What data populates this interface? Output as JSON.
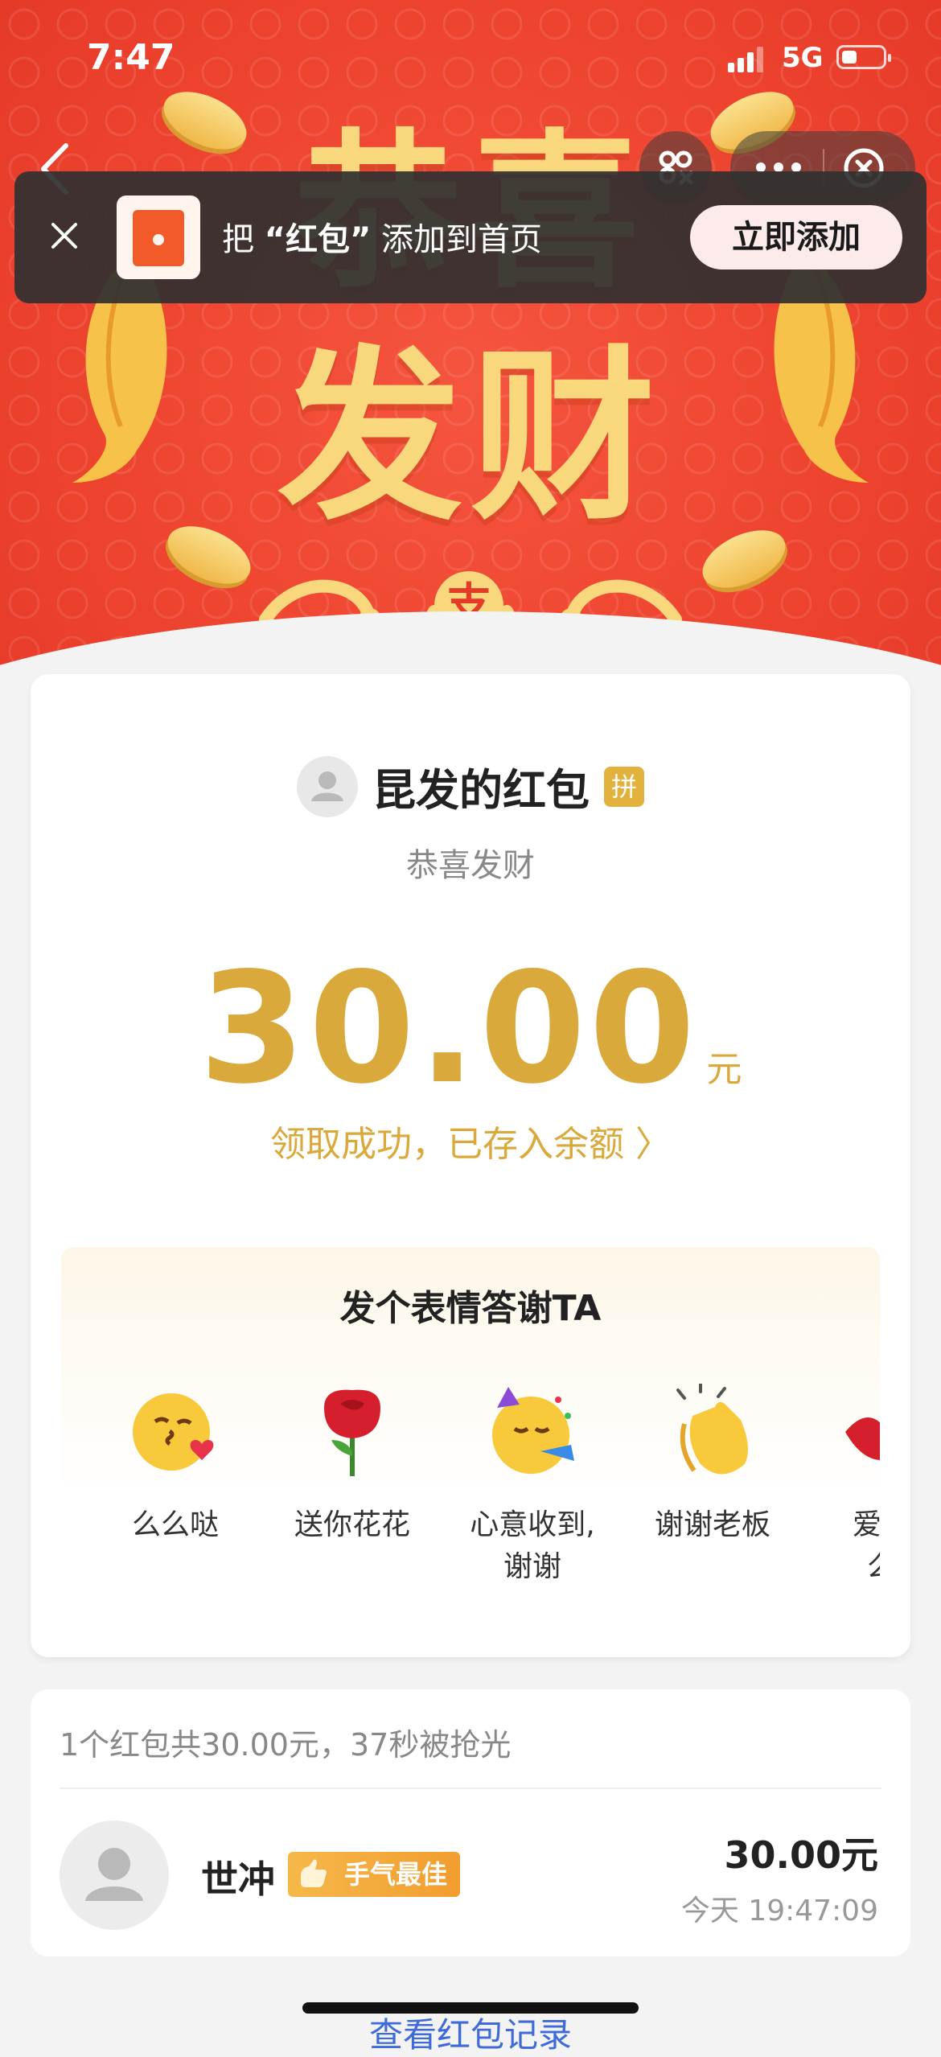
{
  "status_bar": {
    "time": "7:47",
    "network": "5G"
  },
  "hero": {
    "title_line1": "恭喜",
    "title_line2": "发财",
    "seal_char": "支"
  },
  "toast": {
    "text_prefix": "把",
    "text_highlight": "“红包”",
    "text_suffix": "添加到首页",
    "button": "立即添加"
  },
  "packet": {
    "sender": "昆发的红包",
    "badge": "拼",
    "blessing": "恭喜发财",
    "amount": "30.00",
    "unit": "元",
    "status": "领取成功，已存入余额 〉"
  },
  "thanks": {
    "title": "发个表情答谢TA",
    "items": [
      {
        "label": "么么哒",
        "icon": "kiss-emoji-icon"
      },
      {
        "label": "送你花花",
        "icon": "rose-emoji-icon"
      },
      {
        "label": "心意收到,\n谢谢",
        "icon": "party-emoji-icon"
      },
      {
        "label": "谢谢老板",
        "icon": "clap-emoji-icon"
      },
      {
        "label": "爱你\n么",
        "icon": "lips-emoji-icon"
      }
    ]
  },
  "records": {
    "summary": "1个红包共30.00元，37秒被抢光",
    "items": [
      {
        "name": "世冲",
        "badge": "手气最佳",
        "amount": "30.00元",
        "time": "今天 19:47:09"
      }
    ],
    "view_link": "查看红包记录"
  },
  "colors": {
    "hero_red": "#ee4530",
    "gold": "#d9a93c",
    "badge_orange": "#f29d2f",
    "link_blue": "#3f6bd8"
  }
}
